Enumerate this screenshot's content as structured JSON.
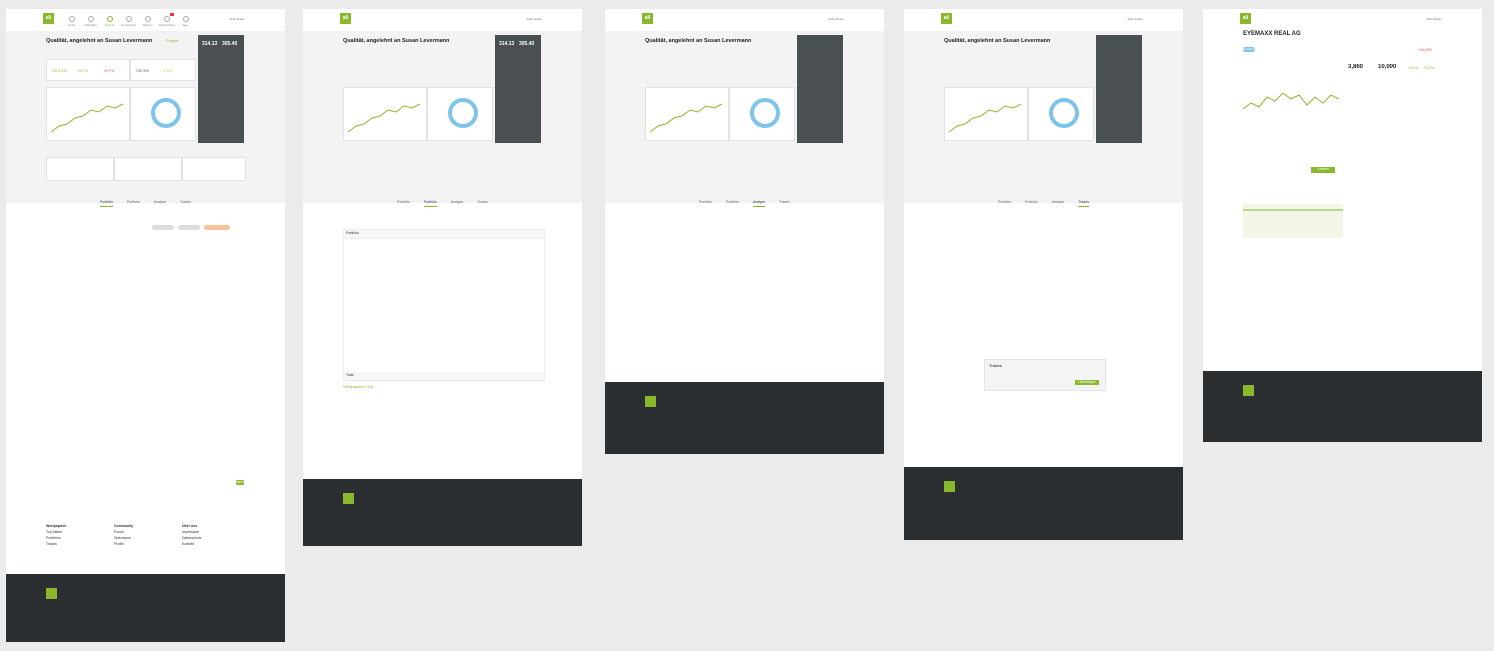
{
  "logo": "ali",
  "nav": [
    "Feed",
    "Watchlist",
    "Depots",
    "Community",
    "Wissen",
    "Nachrichten",
    "Neu"
  ],
  "search": "Aktie finden",
  "profile": {
    "title": "Qualität, angelehnt an Susan Levermann",
    "follow": "Folgen",
    "score_a": "314.13",
    "score_b": "305.40",
    "perf_values": [
      "+103,4%",
      "+6,7%",
      "+0,7%",
      "+33,3%",
      "+7,5%"
    ]
  },
  "tabs": [
    "Portfolio",
    "Portfolio",
    "Analyse",
    "Trades"
  ],
  "stock": {
    "name": "EYEMAXX REAL AG",
    "price": "3,860",
    "price2": "10,000",
    "chg_a": "+0,10",
    "chg_b": "+0,5%",
    "tag": "Realtime",
    "badge": "+24,3%",
    "buy": "Kaufen"
  },
  "trades": {
    "title": "Trades",
    "submit": "Hinzufügen",
    "more": "Mehr laden"
  },
  "portfolio": {
    "label": "Portfolio",
    "total": "Total",
    "summary": "Wertpapiere (13)"
  },
  "footer": {
    "col1": [
      "Wertpapiere",
      "Top Aktien",
      "Portfolios",
      "Trades"
    ],
    "col2": [
      "Community",
      "Forum",
      "Diskussion",
      "Profile"
    ],
    "col3": [
      "Über uns",
      "Impressum",
      "Datenschutz",
      "Kontakt"
    ]
  },
  "colors": {
    "accent": "#8ab82d",
    "dark": "#2b2f31",
    "panel": "#4a4f52",
    "ring": "#7ec3ea"
  }
}
